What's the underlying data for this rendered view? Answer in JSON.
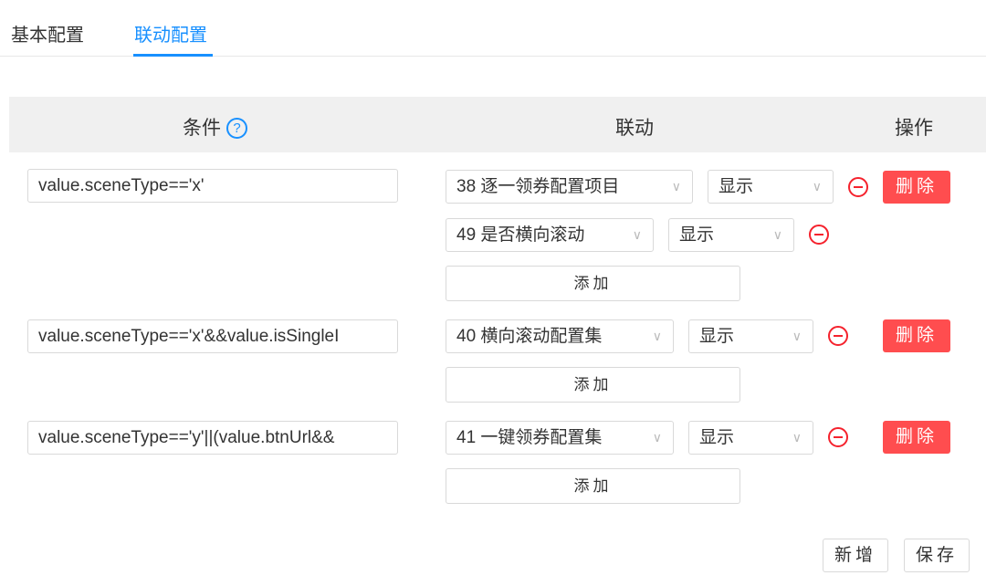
{
  "tabs": [
    {
      "label": "基本配置"
    },
    {
      "label": "联动配置"
    }
  ],
  "columns": {
    "condition": "条件",
    "help": "?",
    "linkage": "联动",
    "action": "操作"
  },
  "rows": [
    {
      "condition": "value.sceneType=='x'",
      "links": [
        {
          "field": "38  逐一领券配置项目",
          "state": "显示"
        },
        {
          "field": "49  是否横向滚动",
          "state": "显示"
        }
      ]
    },
    {
      "condition": "value.sceneType=='x'&&value.isSingleI",
      "links": [
        {
          "field": "40  横向滚动配置集",
          "state": "显示"
        }
      ]
    },
    {
      "condition": "value.sceneType=='y'||(value.btnUrl&&",
      "links": [
        {
          "field": "41  一键领券配置集",
          "state": "显示"
        }
      ]
    }
  ],
  "add_label": "添加",
  "delete_label": "删除",
  "new_label": "新增",
  "save_label": "保存",
  "arrow": "∨"
}
